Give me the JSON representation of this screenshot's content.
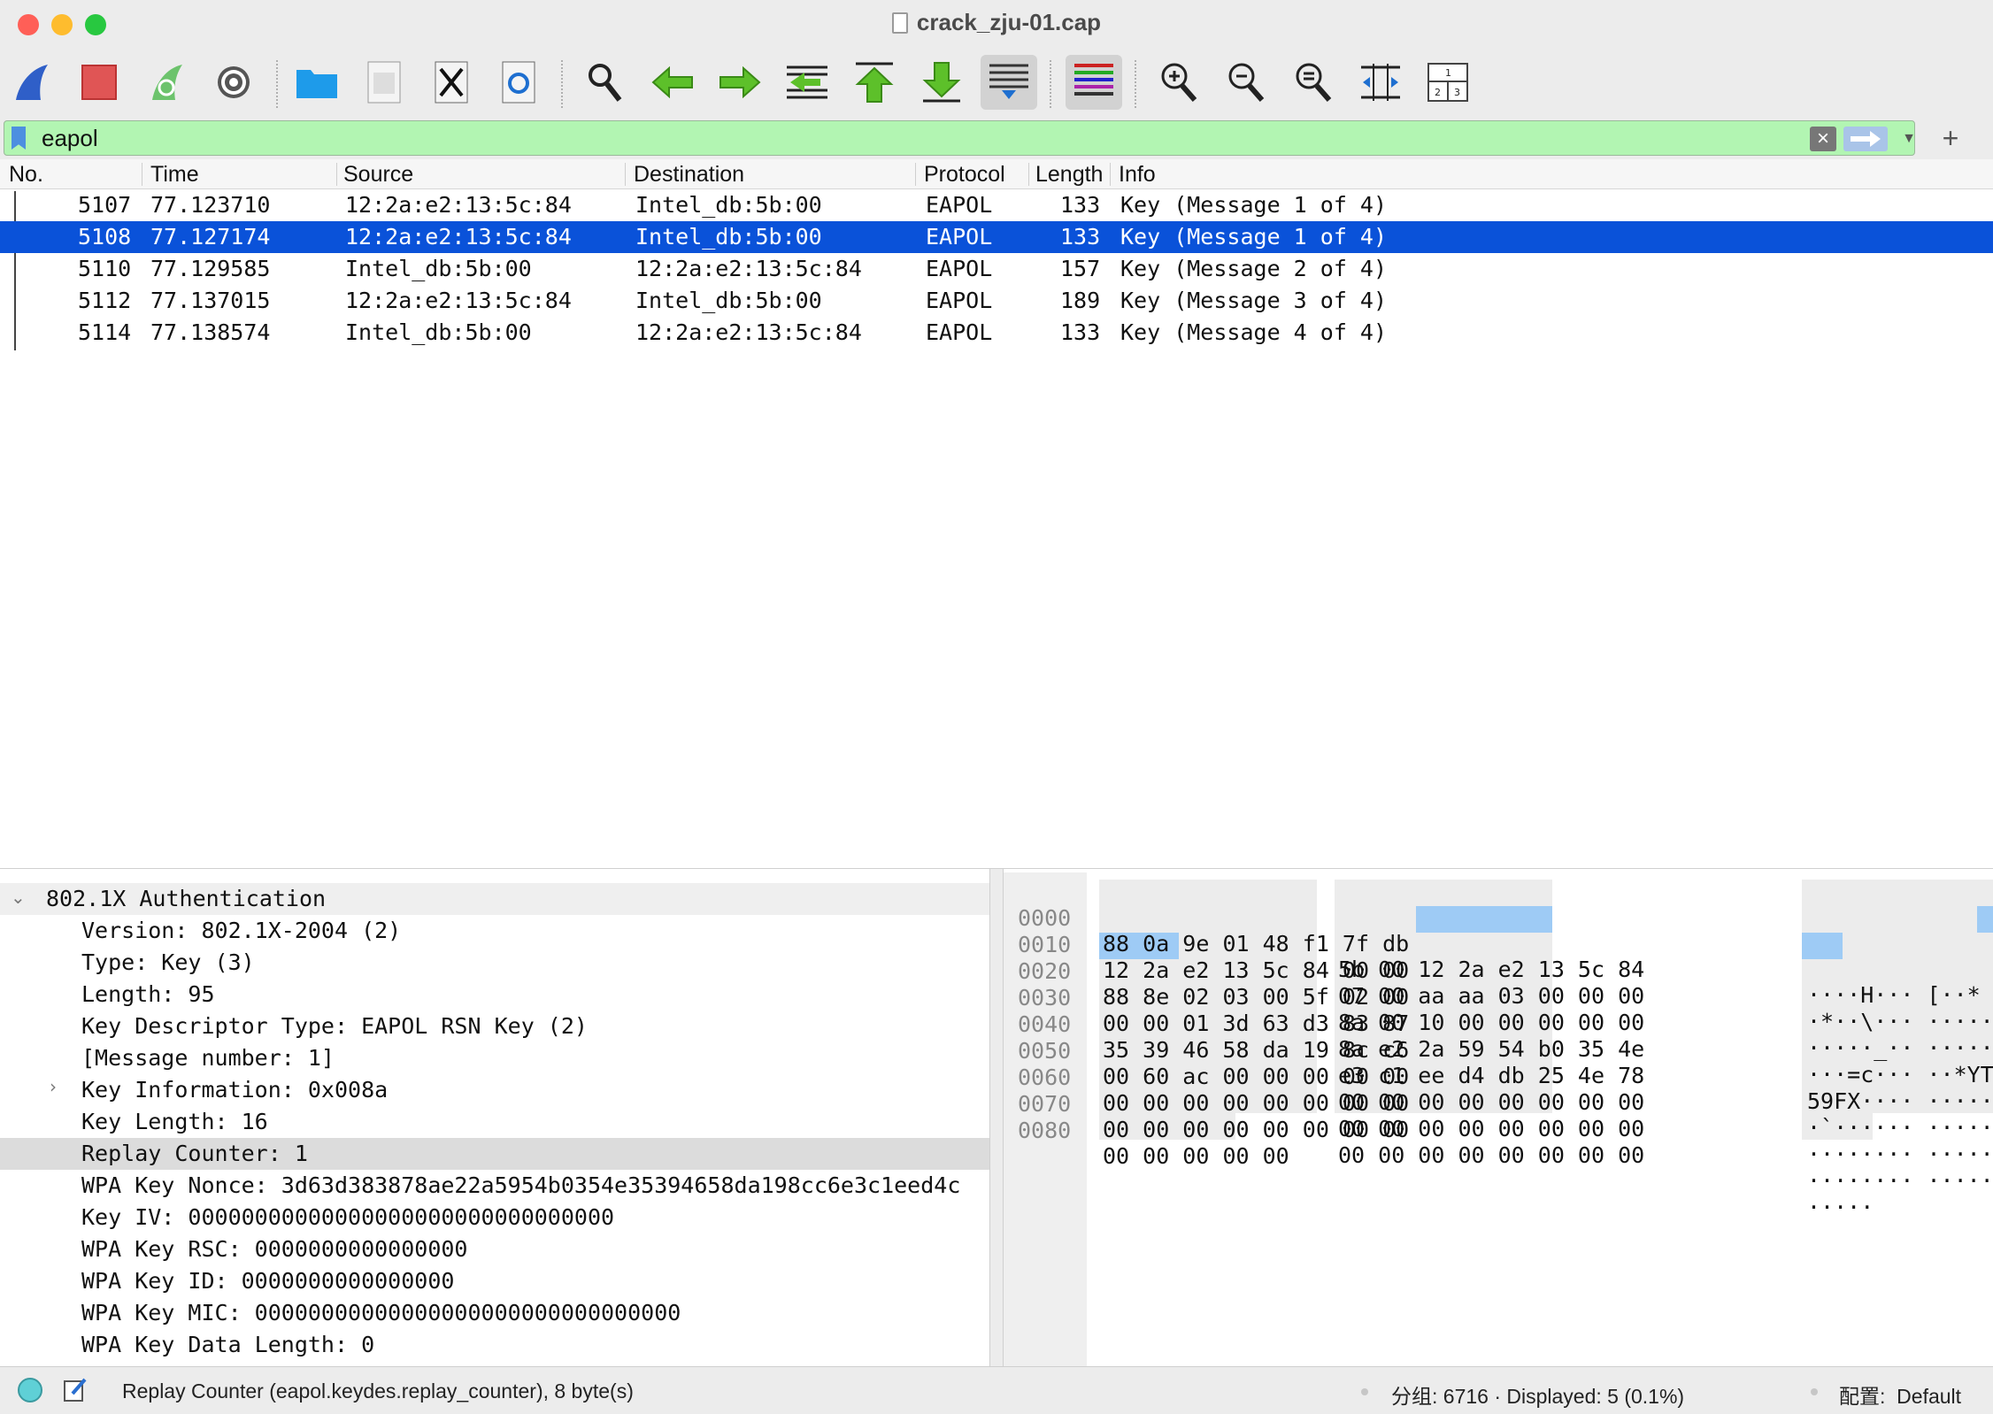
{
  "window": {
    "title": "crack_zju-01.cap",
    "traffic_lights": {
      "close": "#ff5f57",
      "minimize": "#febc2e",
      "zoom": "#28c840"
    }
  },
  "toolbar": {
    "icons": [
      "shark-fin-start-icon",
      "stop-capture-icon",
      "restart-capture-icon",
      "capture-options-icon",
      "open-folder-icon",
      "save-file-icon",
      "close-file-icon",
      "reload-file-icon",
      "find-packet-icon",
      "go-back-icon",
      "go-forward-icon",
      "go-to-packet-icon",
      "first-packet-icon",
      "last-packet-icon",
      "autoscroll-icon",
      "colorize-icon",
      "zoom-in-icon",
      "zoom-out-icon",
      "normal-size-icon",
      "resize-columns-icon",
      "layout-icon"
    ]
  },
  "filter": {
    "value": "eapol",
    "background_color": "#b2f5b2"
  },
  "packet_list": {
    "columns": [
      "No.",
      "Time",
      "Source",
      "Destination",
      "Protocol",
      "Length",
      "Info"
    ],
    "rows": [
      {
        "no": "5107",
        "time": "77.123710",
        "source": "12:2a:e2:13:5c:84",
        "destination": "Intel_db:5b:00",
        "protocol": "EAPOL",
        "length": "133",
        "info": "Key (Message 1 of 4)"
      },
      {
        "no": "5108",
        "time": "77.127174",
        "source": "12:2a:e2:13:5c:84",
        "destination": "Intel_db:5b:00",
        "protocol": "EAPOL",
        "length": "133",
        "info": "Key (Message 1 of 4)"
      },
      {
        "no": "5110",
        "time": "77.129585",
        "source": "Intel_db:5b:00",
        "destination": "12:2a:e2:13:5c:84",
        "protocol": "EAPOL",
        "length": "157",
        "info": "Key (Message 2 of 4)"
      },
      {
        "no": "5112",
        "time": "77.137015",
        "source": "12:2a:e2:13:5c:84",
        "destination": "Intel_db:5b:00",
        "protocol": "EAPOL",
        "length": "189",
        "info": "Key (Message 3 of 4)"
      },
      {
        "no": "5114",
        "time": "77.138574",
        "source": "Intel_db:5b:00",
        "destination": "12:2a:e2:13:5c:84",
        "protocol": "EAPOL",
        "length": "133",
        "info": "Key (Message 4 of 4)"
      }
    ],
    "selection_color": "#0a52d9"
  },
  "details": {
    "rows": [
      {
        "text": "802.1X Authentication",
        "expander": "open"
      },
      {
        "text": "Version: 802.1X-2004 (2)"
      },
      {
        "text": "Type: Key (3)"
      },
      {
        "text": "Length: 95"
      },
      {
        "text": "Key Descriptor Type: EAPOL RSN Key (2)"
      },
      {
        "text": "[Message number: 1]"
      },
      {
        "text": "Key Information: 0x008a",
        "expander": "closed"
      },
      {
        "text": "Key Length: 16"
      },
      {
        "text": "Replay Counter: 1",
        "selected": true
      },
      {
        "text": "WPA Key Nonce: 3d63d383878ae22a5954b0354e35394658da198cc6e3c1eed4c"
      },
      {
        "text": "Key IV: 00000000000000000000000000000000"
      },
      {
        "text": "WPA Key RSC: 0000000000000000"
      },
      {
        "text": "WPA Key ID: 0000000000000000"
      },
      {
        "text": "WPA Key MIC: 00000000000000000000000000000000"
      },
      {
        "text": "WPA Key Data Length: 0"
      }
    ]
  },
  "bytes": {
    "rows": [
      {
        "offset": "0000",
        "hex_a": "88 0a 9e 01 48 f1 7f db",
        "hex_b": "5b 00 12 2a e2 13 5c 84",
        "ascii": "····H··· [··*"
      },
      {
        "offset": "0010",
        "hex_a": "12 2a e2 13 5c 84 00 00",
        "hex_b": "07 00 aa aa 03 00 00 00",
        "ascii": "·*··\\··· ·····"
      },
      {
        "offset": "0020",
        "hex_a": "88 8e 02 03 00 5f 02 00",
        "hex_b": "8a 00 10 00 00 00 00 00",
        "ascii": "·····_·· ·····"
      },
      {
        "offset": "0030",
        "hex_a": "00 00 01 3d 63 d3 83 87",
        "hex_b": "8a e2 2a 59 54 b0 35 4e",
        "ascii": "···=c··· ··*YT"
      },
      {
        "offset": "0040",
        "hex_a": "35 39 46 58 da 19 8c c6",
        "hex_b": "e3 c1 ee d4 db 25 4e 78",
        "ascii": "59FX···· ·····"
      },
      {
        "offset": "0050",
        "hex_a": "00 60 ac 00 00 00 00 00",
        "hex_b": "00 00 00 00 00 00 00 00",
        "ascii": "·`······ ·····"
      },
      {
        "offset": "0060",
        "hex_a": "00 00 00 00 00 00 00 00",
        "hex_b": "00 00 00 00 00 00 00 00",
        "ascii": "········ ·····"
      },
      {
        "offset": "0070",
        "hex_a": "00 00 00 00 00 00 00 00",
        "hex_b": "00 00 00 00 00 00 00 00",
        "ascii": "········ ·····"
      },
      {
        "offset": "0080",
        "hex_a": "00 00 00 00 00",
        "hex_b": "",
        "ascii": "·····"
      }
    ],
    "selected_bytes": "Replay Counter: 00 00 00 00 00 00 00 01",
    "selection_color": "#9ecbf5"
  },
  "status": {
    "field": "Replay Counter (eapol.keydes.replay_counter), 8 byte(s)",
    "packets": "分组: 6716 · Displayed: 5 (0.1%)",
    "profile": "配置:  Default"
  }
}
